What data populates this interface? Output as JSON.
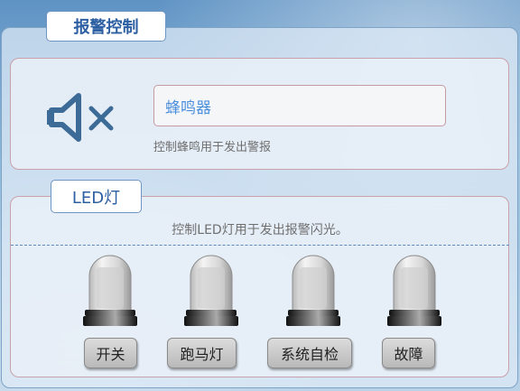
{
  "alarm_section": {
    "title": "报警控制",
    "buzzer_label": "蜂鸣器",
    "buzzer_hint": "控制蜂鸣用于发出警报",
    "icon": "speaker-mute-icon"
  },
  "led_section": {
    "title": "LED灯",
    "hint": "控制LED灯用于发出报警闪光。",
    "buttons": [
      {
        "label": "开关"
      },
      {
        "label": "跑马灯"
      },
      {
        "label": "系统自检"
      },
      {
        "label": "故障"
      }
    ],
    "lamp_icon": "warning-lamp-icon"
  },
  "colors": {
    "accent_blue": "#2d5fa3",
    "input_text": "#4c90dd",
    "panel_border": "#c9a1a8"
  }
}
